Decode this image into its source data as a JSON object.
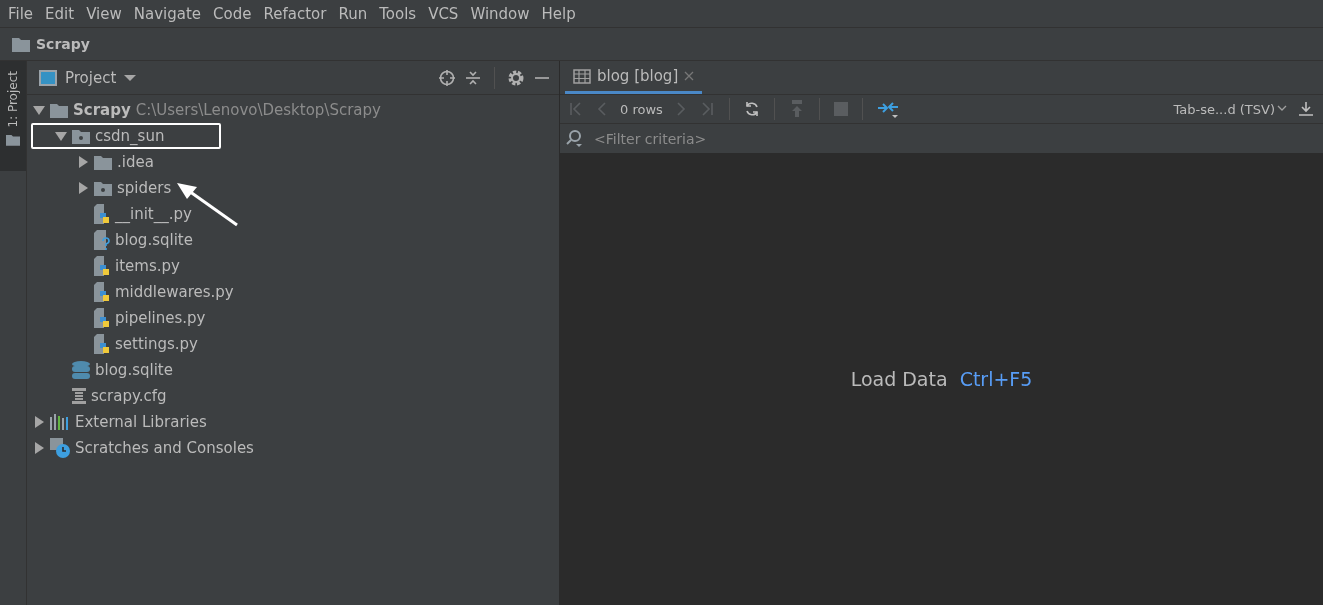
{
  "menu": [
    "File",
    "Edit",
    "View",
    "Navigate",
    "Code",
    "Refactor",
    "Run",
    "Tools",
    "VCS",
    "Window",
    "Help"
  ],
  "breadcrumb": {
    "label": "Scrapy"
  },
  "side_tab": {
    "label": "1: Project",
    "selected": true
  },
  "project_panel": {
    "title": "Project",
    "tree": [
      {
        "label": "Scrapy",
        "path": "C:\\Users\\Lenovo\\Desktop\\Scrapy",
        "kind": "folder",
        "expanded": true,
        "children": [
          {
            "label": "csdn_sun",
            "kind": "module",
            "expanded": true,
            "highlighted": true,
            "children": [
              {
                "label": ".idea",
                "kind": "folder",
                "expanded": false
              },
              {
                "label": "spiders",
                "kind": "module",
                "expanded": false,
                "arrow": true
              },
              {
                "label": "__init__.py",
                "kind": "python"
              },
              {
                "label": "blog.sqlite",
                "kind": "unknown"
              },
              {
                "label": "items.py",
                "kind": "python"
              },
              {
                "label": "middlewares.py",
                "kind": "python"
              },
              {
                "label": "pipelines.py",
                "kind": "python"
              },
              {
                "label": "settings.py",
                "kind": "python"
              }
            ]
          },
          {
            "label": "blog.sqlite",
            "kind": "database"
          },
          {
            "label": "scrapy.cfg",
            "kind": "config"
          }
        ]
      },
      {
        "label": "External Libraries",
        "kind": "libraries",
        "expanded": false
      },
      {
        "label": "Scratches and Consoles",
        "kind": "scratches",
        "expanded": false
      }
    ]
  },
  "editor": {
    "tabs": [
      {
        "label": "blog [blog]",
        "selected": true
      }
    ],
    "rows": "0 rows",
    "format": "Tab-se...d (TSV)",
    "filter_placeholder": "<Filter criteria>",
    "load_label": "Load Data",
    "load_shortcut": "Ctrl+F5"
  }
}
